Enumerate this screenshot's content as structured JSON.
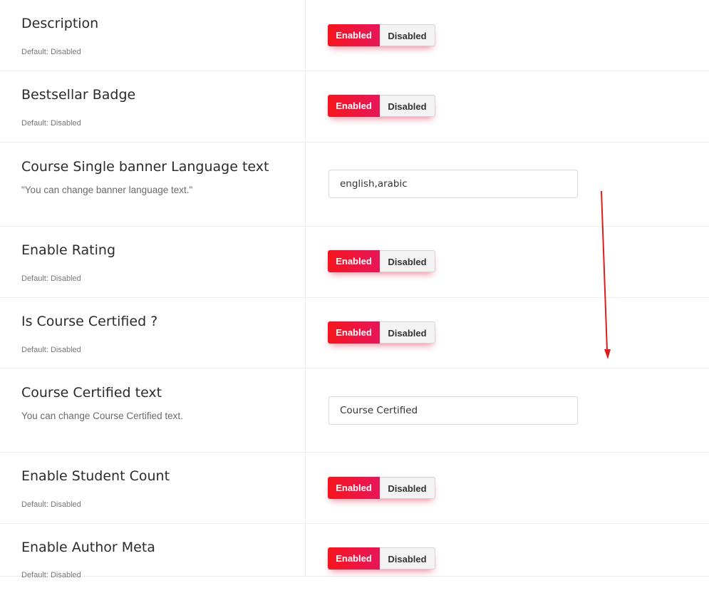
{
  "settings": [
    {
      "kind": "toggle",
      "title": "Description",
      "hint": "Default: Disabled",
      "enabled_label": "Enabled",
      "disabled_label": "Disabled"
    },
    {
      "kind": "toggle",
      "title": "Bestsellar Badge",
      "hint": "Default: Disabled",
      "enabled_label": "Enabled",
      "disabled_label": "Disabled"
    },
    {
      "kind": "text",
      "title": "Course Single banner Language text",
      "description": "\"You can change banner language text.\"",
      "value": "english,arabic"
    },
    {
      "kind": "toggle",
      "title": "Enable Rating",
      "hint": "Default: Disabled",
      "enabled_label": "Enabled",
      "disabled_label": "Disabled"
    },
    {
      "kind": "toggle",
      "title": "Is Course Certified ?",
      "hint": "Default: Disabled",
      "enabled_label": "Enabled",
      "disabled_label": "Disabled"
    },
    {
      "kind": "text",
      "title": "Course Certified text",
      "description": "You can change Course Certified text.",
      "value": "Course Certified"
    },
    {
      "kind": "toggle",
      "title": "Enable Student Count",
      "hint": "Default: Disabled",
      "enabled_label": "Enabled",
      "disabled_label": "Disabled"
    },
    {
      "kind": "toggle",
      "title": "Enable Author Meta",
      "hint": "Default: Disabled",
      "enabled_label": "Enabled",
      "disabled_label": "Disabled"
    }
  ],
  "colors": {
    "accent_start": "#f5151d",
    "accent_end": "#e8165a",
    "annotation_arrow": "#e01b1b"
  },
  "annotation": {
    "icon": "down-arrow-icon"
  }
}
